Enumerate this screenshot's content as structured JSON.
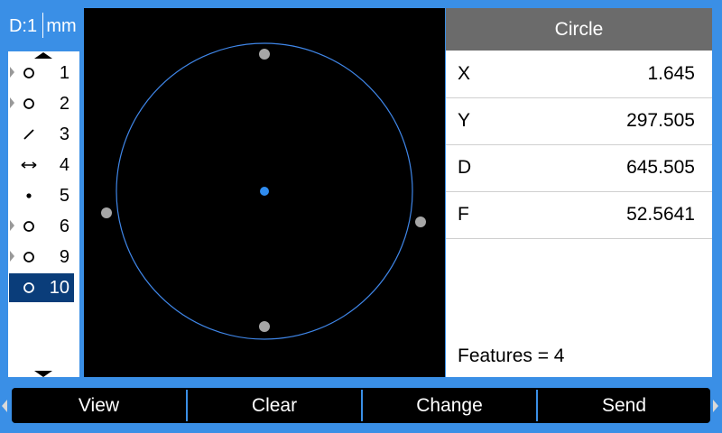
{
  "header": {
    "datum": "D:1",
    "unit": "mm"
  },
  "features": [
    {
      "icon": "circle-icon",
      "label": "1",
      "marker": true,
      "selected": false
    },
    {
      "icon": "circle-icon",
      "label": "2",
      "marker": true,
      "selected": false
    },
    {
      "icon": "line-icon",
      "label": "3",
      "marker": false,
      "selected": false
    },
    {
      "icon": "distance-icon",
      "label": "4",
      "marker": false,
      "selected": false
    },
    {
      "icon": "point-icon",
      "label": "5",
      "marker": false,
      "selected": false
    },
    {
      "icon": "circle-icon",
      "label": "6",
      "marker": true,
      "selected": false
    },
    {
      "icon": "circle-icon",
      "label": "9",
      "marker": true,
      "selected": false
    },
    {
      "icon": "circle-icon",
      "label": "10",
      "marker": false,
      "selected": true
    }
  ],
  "results": {
    "title": "Circle",
    "rows": [
      {
        "label": "X",
        "value": "1.645"
      },
      {
        "label": "Y",
        "value": "297.505"
      },
      {
        "label": "D",
        "value": "645.505"
      },
      {
        "label": "F",
        "value": "52.5641"
      }
    ],
    "features_count": "Features = 4"
  },
  "softkeys": [
    "View",
    "Clear",
    "Change",
    "Send"
  ],
  "colors": {
    "background": "#3a8fe6",
    "selected_row": "#0a3d7a",
    "circle_outline": "#3f86e8",
    "center_point": "#2f8cf0",
    "probe_points": "#a6a6a6",
    "title_bar": "#6b6b6b"
  }
}
